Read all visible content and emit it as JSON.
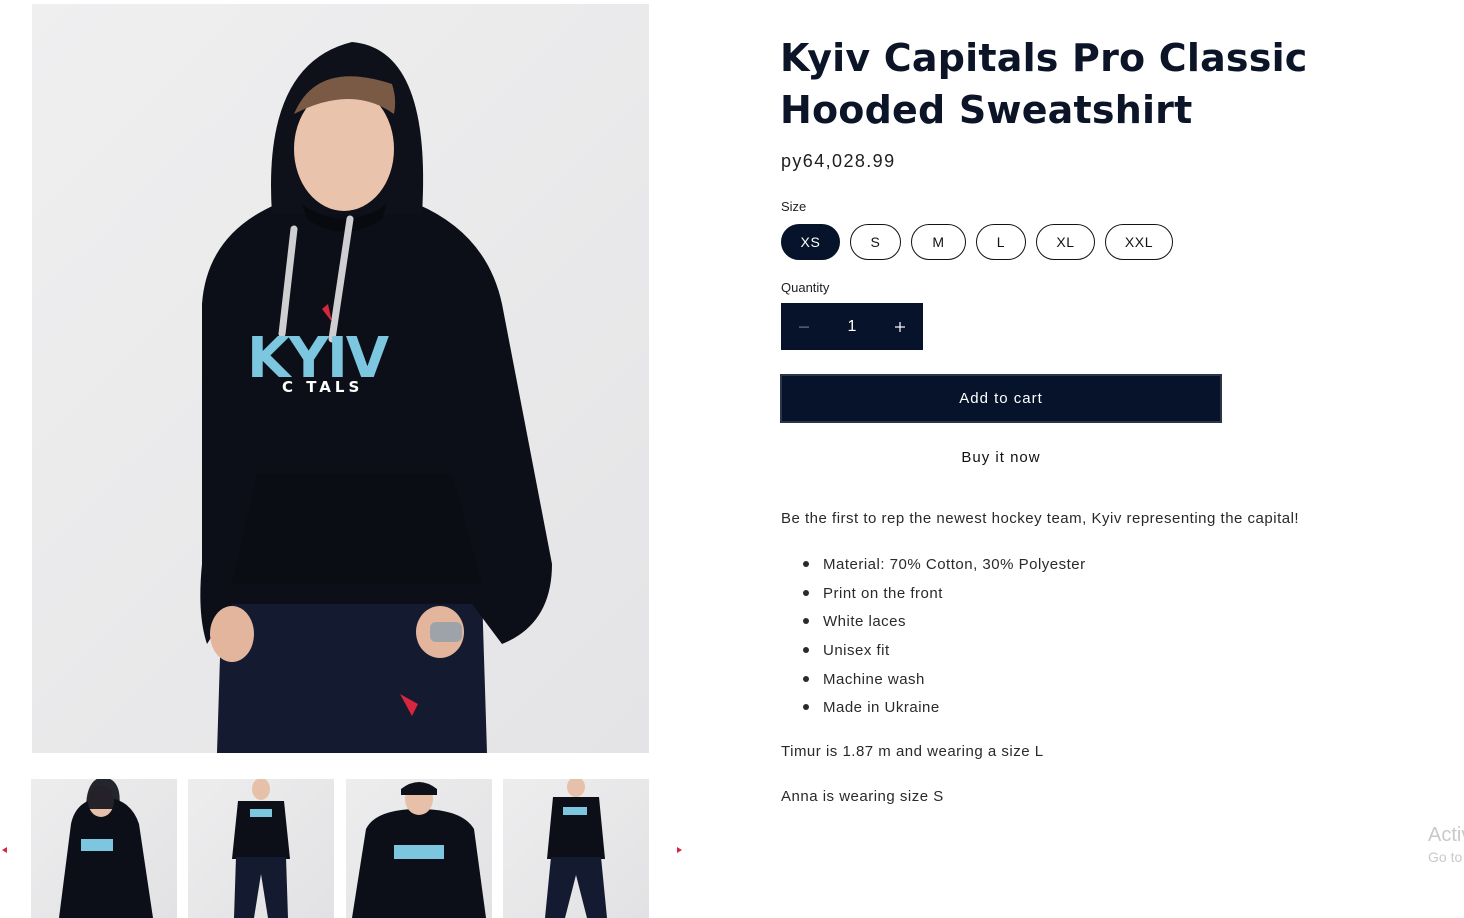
{
  "product": {
    "title_line1": "Kyiv Capitals Pro Classic",
    "title_line2": "Hooded Sweatshirt",
    "price": "py64,028.99",
    "size_label": "Size",
    "sizes": [
      "XS",
      "S",
      "M",
      "L",
      "XL",
      "XXL"
    ],
    "selected_size": "XS",
    "quantity_label": "Quantity",
    "quantity": "1",
    "add_to_cart": "Add to cart",
    "buy_now": "Buy it now"
  },
  "gallery": {
    "main_print_line1": "KYIV",
    "main_print_line2": "C TALS",
    "thumb_count": 4
  },
  "description": {
    "intro": "Be the first to rep the newest hockey team, Kyiv representing the capital!",
    "features": [
      "Material: 70% Cotton, 30% Polyester",
      "Print on the front",
      "White laces",
      "Unisex fit",
      "Machine wash",
      "Made in Ukraine"
    ],
    "note_1": "Timur is 1.87 m and wearing a size L",
    "note_2": "Anna is wearing size S"
  },
  "watermark": {
    "line1": "Activ",
    "line2": "Go to"
  },
  "colors": {
    "navy": "#06132a",
    "print_blue": "#7cc6df",
    "arrow_red": "#d7263d"
  }
}
